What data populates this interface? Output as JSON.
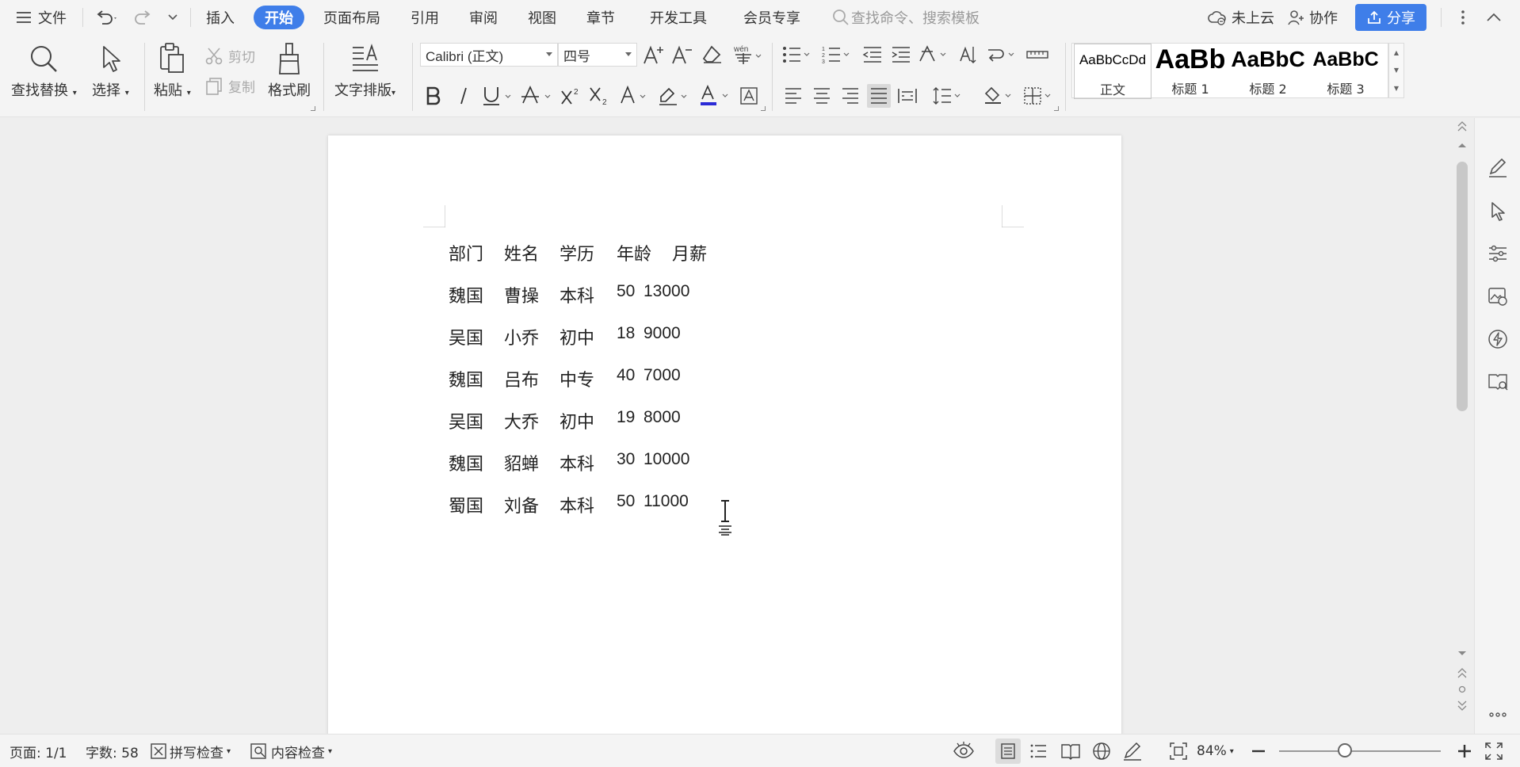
{
  "menubar": {
    "file_label": "文件",
    "tabs": [
      "插入",
      "开始",
      "页面布局",
      "引用",
      "审阅",
      "视图",
      "章节",
      "开发工具",
      "会员专享"
    ],
    "search_placeholder": "查找命令、搜索模板",
    "cloud_label": "未上云",
    "collab_label": "协作",
    "share_label": "分享"
  },
  "ribbon": {
    "find_replace": "查找替换",
    "select": "选择",
    "paste": "粘贴",
    "cut": "剪切",
    "copy": "复制",
    "format_painter": "格式刷",
    "text_layout": "文字排版",
    "font_name": "Calibri (正文)",
    "font_size": "四号",
    "styles": [
      {
        "preview": "AaBbCcDd",
        "name": "正文"
      },
      {
        "preview": "AaBb",
        "name": "标题 1"
      },
      {
        "preview": "AaBbC",
        "name": "标题 2"
      },
      {
        "preview": "AaBbC",
        "name": "标题 3"
      }
    ]
  },
  "document": {
    "rows": [
      [
        "部门",
        "姓名",
        "学历",
        "年龄",
        "月薪"
      ],
      [
        "魏国",
        "曹操",
        "本科",
        "50",
        "13000"
      ],
      [
        "吴国",
        "小乔",
        "初中",
        "18",
        "9000"
      ],
      [
        "魏国",
        "吕布",
        "中专",
        "40",
        "7000"
      ],
      [
        "吴国",
        "大乔",
        "初中",
        "19",
        "8000"
      ],
      [
        "魏国",
        "貂蝉",
        "本科",
        "30",
        "10000"
      ],
      [
        "蜀国",
        "刘备",
        "本科",
        "50",
        "11000"
      ]
    ]
  },
  "statusbar": {
    "page": "页面: 1/1",
    "word_count": "字数: 58",
    "spell_check": "拼写检查",
    "content_check": "内容检查",
    "zoom": "84%"
  },
  "colors": {
    "accent": "#3f7ee9",
    "font_color_bar": "#2b2bd6"
  }
}
